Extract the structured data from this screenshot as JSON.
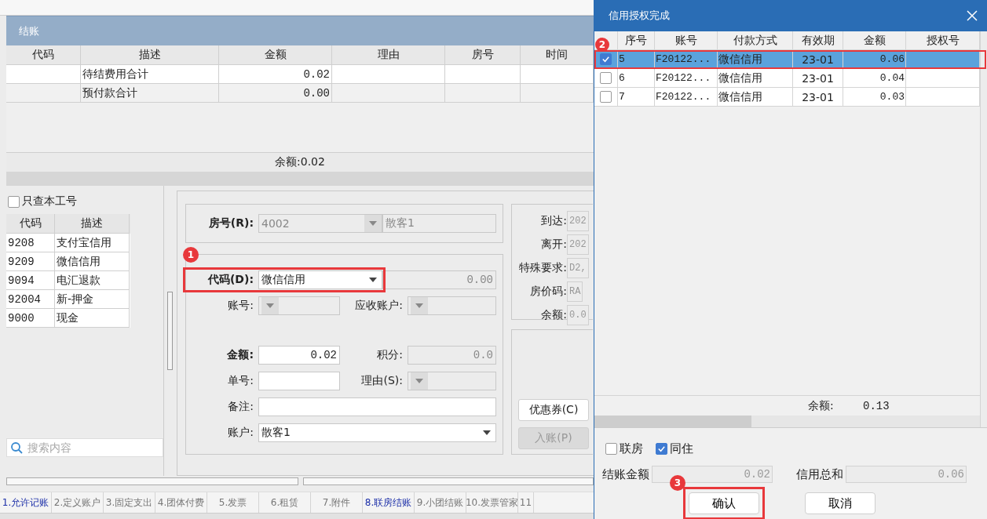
{
  "panel": {
    "title": "结账"
  },
  "bill_table": {
    "columns": [
      "代码",
      "描述",
      "金额",
      "理由",
      "房号",
      "时间"
    ],
    "rows": [
      {
        "cells": [
          "",
          "待结费用合计",
          "0.02",
          "",
          "",
          ""
        ]
      },
      {
        "cells": [
          "",
          "预付款合计",
          "0.00",
          "",
          "",
          ""
        ]
      }
    ],
    "balance": "余额:0.02"
  },
  "filter": {
    "label": "只查本工号",
    "checked": false
  },
  "code_table": {
    "columns": [
      "代码",
      "描述"
    ],
    "rows": [
      {
        "code": "9208",
        "desc": "支付宝信用"
      },
      {
        "code": "9209",
        "desc": "微信信用"
      },
      {
        "code": "9094",
        "desc": "电汇退款"
      },
      {
        "code": "92004",
        "desc": "新-押金"
      },
      {
        "code": "9000",
        "desc": "现金"
      }
    ]
  },
  "search": {
    "placeholder": "搜索内容"
  },
  "form": {
    "room": [
      {
        "label": "房号(R):",
        "value": "4002",
        "kind": "select",
        "disabled": true,
        "bold": true
      },
      {
        "value": "散客1",
        "kind": "text",
        "disabled": true
      }
    ],
    "rows": [
      [
        {
          "label": "代码(D):",
          "value": "微信信用",
          "kind": "select",
          "disabled": false,
          "bold": true,
          "marker": "1"
        },
        {
          "value": "0.00",
          "kind": "number",
          "disabled": true
        }
      ],
      [
        {
          "label": "账号:",
          "kind": "select",
          "disabled": true
        },
        {
          "label": "应收账户:",
          "kind": "select",
          "disabled": true
        }
      ],
      [
        {
          "label": "金额:",
          "value": "0.02",
          "kind": "number",
          "disabled": false,
          "bold": true
        },
        {
          "label": "积分:",
          "value": "0.0",
          "kind": "number",
          "disabled": true
        }
      ],
      [
        {
          "label": "单号:",
          "kind": "text",
          "disabled": false
        },
        {
          "label": "理由(S):",
          "kind": "select",
          "disabled": true
        }
      ],
      [
        {
          "label": "备注:",
          "kind": "text",
          "disabled": false
        }
      ],
      [
        {
          "label": "账户:",
          "value": "散客1",
          "kind": "select",
          "disabled": false
        }
      ]
    ]
  },
  "info": [
    {
      "label": "到达:",
      "value": "202"
    },
    {
      "label": "离开:",
      "value": "202"
    },
    {
      "label": "特殊要求:",
      "value": "D2,"
    },
    {
      "label": "房价码:",
      "value": "RA"
    },
    {
      "label": "余额:",
      "value": "0.0"
    }
  ],
  "actions": [
    {
      "label": "优惠券(C)",
      "disabled": false
    },
    {
      "label": "入账(P)",
      "disabled": true
    }
  ],
  "tabs": [
    {
      "label": "1.允许记账",
      "highlighted": true
    },
    {
      "label": "2.定义账户",
      "highlighted": false
    },
    {
      "label": "3.固定支出",
      "highlighted": false
    },
    {
      "label": "4.团体付费",
      "highlighted": false
    },
    {
      "label": "5.发票",
      "highlighted": false
    },
    {
      "label": "6.租赁",
      "highlighted": false
    },
    {
      "label": "7.附件",
      "highlighted": false
    },
    {
      "label": "8.联房结账",
      "highlighted": true
    },
    {
      "label": "9.小团结账",
      "highlighted": false
    },
    {
      "label": "10.发票管家",
      "highlighted": false
    },
    {
      "label": "11",
      "highlighted": false
    }
  ],
  "dialog": {
    "title": "信用授权完成",
    "columns": [
      "序号",
      "账号",
      "付款方式",
      "有效期",
      "金额",
      "授权号"
    ],
    "rows": [
      {
        "checked": true,
        "selected": true,
        "marker": "2",
        "cells": [
          "5",
          "F20122...",
          "微信信用",
          "23-01",
          "0.06",
          ""
        ]
      },
      {
        "checked": false,
        "selected": false,
        "cells": [
          "6",
          "F20122...",
          "微信信用",
          "23-01",
          "0.04",
          ""
        ]
      },
      {
        "checked": false,
        "selected": false,
        "cells": [
          "7",
          "F20122...",
          "微信信用",
          "23-01",
          "0.03",
          ""
        ]
      }
    ],
    "balance": {
      "label": "余额:",
      "value": "0.13"
    },
    "options": [
      {
        "label": "联房",
        "checked": false
      },
      {
        "label": "同住",
        "checked": true
      }
    ],
    "totals": [
      {
        "label": "结账金额",
        "value": "0.02"
      },
      {
        "label": "信用总和",
        "value": "0.06"
      }
    ],
    "buttons": [
      {
        "label": "确认",
        "marker": "3"
      },
      {
        "label": "取消"
      }
    ]
  }
}
